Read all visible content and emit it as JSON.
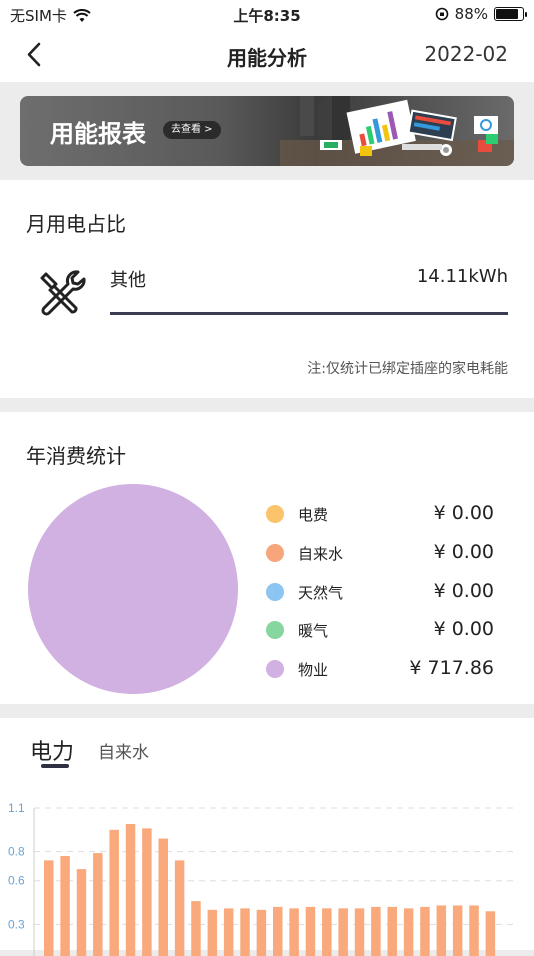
{
  "status": {
    "carrier": "无SIM卡",
    "time": "上午8:35",
    "battery": "88%",
    "battery_level": 0.88
  },
  "nav": {
    "title": "用能分析",
    "date": "2022-02"
  },
  "banner": {
    "title": "用能报表",
    "action": "去查看 >"
  },
  "monthly": {
    "title": "月用电占比",
    "item_label": "其他",
    "item_value": "14.11kWh",
    "note": "注:仅统计已绑定插座的家电耗能"
  },
  "yearly": {
    "title": "年消费统计",
    "legend": [
      {
        "name": "电费",
        "value": "¥ 0.00",
        "color": "#fbc46b"
      },
      {
        "name": "自来水",
        "value": "¥ 0.00",
        "color": "#f7a57a"
      },
      {
        "name": "天然气",
        "value": "¥ 0.00",
        "color": "#8cc4f2"
      },
      {
        "name": "暖气",
        "value": "¥ 0.00",
        "color": "#86d6a0"
      },
      {
        "name": "物业",
        "value": "¥ 717.86",
        "color": "#d1b0e2"
      }
    ]
  },
  "usage": {
    "tabs": [
      "电力",
      "自来水"
    ]
  },
  "chart_data": {
    "type": "bar",
    "y_ticks": [
      "1.1",
      "0.8",
      "0.6",
      "0.3"
    ],
    "ylim": [
      0,
      1.1
    ],
    "values": [
      0.74,
      0.77,
      0.68,
      0.79,
      0.95,
      0.99,
      0.96,
      0.89,
      0.74,
      0.46,
      0.4,
      0.41,
      0.41,
      0.4,
      0.42,
      0.41,
      0.42,
      0.41,
      0.41,
      0.41,
      0.42,
      0.42,
      0.41,
      0.42,
      0.43,
      0.43,
      0.43,
      0.39
    ],
    "bar_color": "#f9a97c",
    "grid": true
  }
}
